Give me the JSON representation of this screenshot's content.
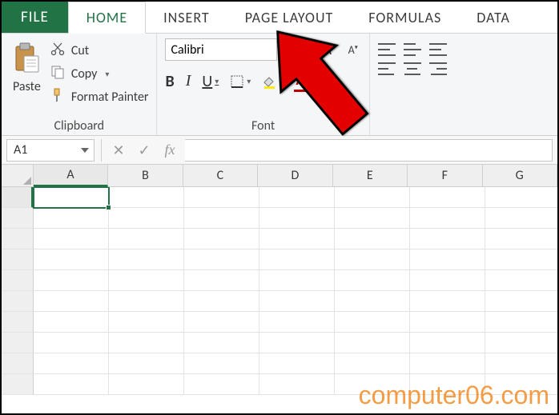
{
  "ribbon": {
    "tabs": {
      "file": "FILE",
      "home": "HOME",
      "insert": "INSERT",
      "page_layout": "PAGE LAYOUT",
      "formulas": "FORMULAS",
      "data": "DATA"
    },
    "active_tab": "HOME"
  },
  "clipboard": {
    "paste_label": "Paste",
    "cut_label": "Cut",
    "copy_label": "Copy",
    "format_painter_label": "Format Painter",
    "group_label": "Clipboard"
  },
  "font": {
    "name_value": "Calibri",
    "size_value": "",
    "bold": "B",
    "italic": "I",
    "underline": "U",
    "group_label": "Font",
    "increase_aa": "A",
    "increase_aa2": "A",
    "decrease_aa": "A"
  },
  "formula_bar": {
    "name_box_value": "A1",
    "cancel_glyph": "✕",
    "enter_glyph": "✓",
    "fx_glyph": "fx",
    "formula_value": ""
  },
  "columns": [
    "A",
    "B",
    "C",
    "D",
    "E",
    "F",
    "G"
  ],
  "rows": [
    "",
    "",
    "",
    "",
    "",
    "",
    "",
    "",
    "",
    ""
  ],
  "selected_cell": "A1",
  "watermark": "computer06.com"
}
